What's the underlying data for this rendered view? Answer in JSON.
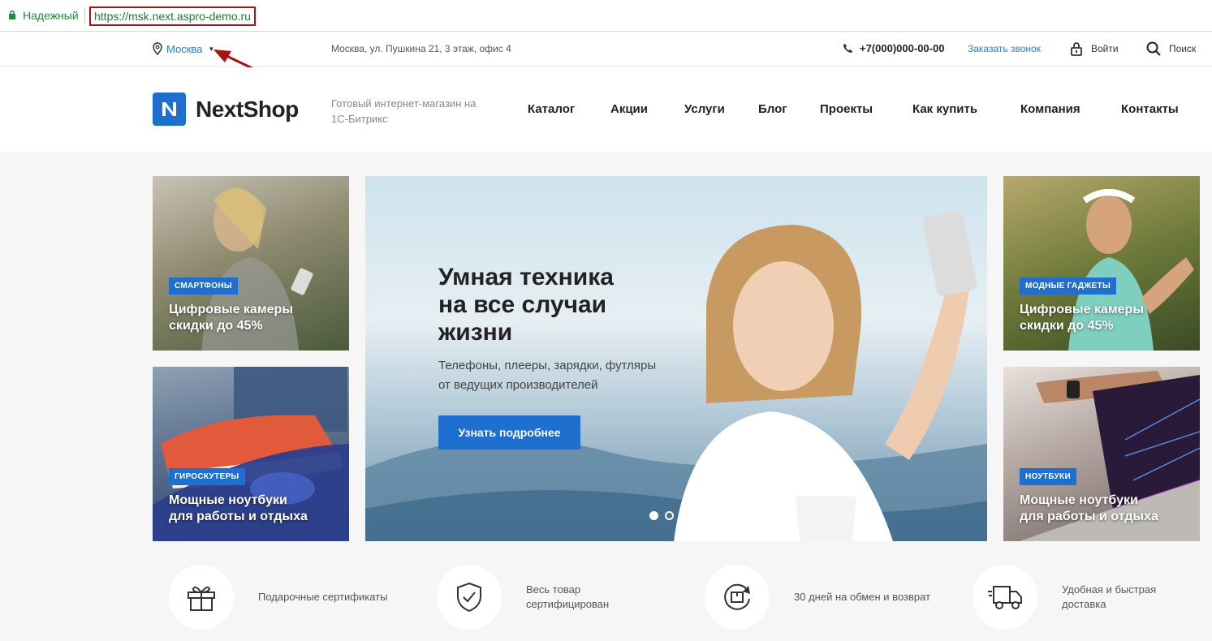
{
  "browser": {
    "secure_label": "Надежный",
    "url": "https://msk.next.aspro-demo.ru"
  },
  "topbar": {
    "city": "Москва",
    "address": "Москва, ул. Пушкина 21, 3 этаж, офис 4",
    "phone": "+7(000)000-00-00",
    "callback": "Заказать звонок",
    "login": "Войти",
    "search": "Поиск"
  },
  "header": {
    "logo_text": "NextShop",
    "tagline": "Готовый интернет-магазин на 1С-Битрикс",
    "nav": [
      "Каталог",
      "Акции",
      "Услуги",
      "Блог",
      "Проекты",
      "Как купить",
      "Компания",
      "Контакты"
    ]
  },
  "banners": {
    "left_top": {
      "badge": "СМАРТФОНЫ",
      "title": "Цифровые камеры\nскидки до 45%"
    },
    "left_bottom": {
      "badge": "ГИРОСКУТЕРЫ",
      "title": "Мощные ноутбуки\nдля работы и отдыха"
    },
    "right_top": {
      "badge": "МОДНЫЕ ГАДЖЕТЫ",
      "title": "Цифровые камеры\nскидки до 45%"
    },
    "right_bottom": {
      "badge": "НОУТБУКИ",
      "title": "Мощные ноутбуки\nдля работы и отдыха"
    }
  },
  "hero": {
    "title": "Умная техника\nна все случаи\nжизни",
    "subtitle": "Телефоны, плееры, зарядки, футляры\nот ведущих производителей",
    "button": "Узнать подробнее",
    "slides_total": 4,
    "active_slide": 1
  },
  "features": [
    {
      "icon": "gift-icon",
      "text": "Подарочные сертификаты"
    },
    {
      "icon": "shield-check-icon",
      "text": "Весь товар\nсертифицирован"
    },
    {
      "icon": "return-box-icon",
      "text": "30 дней на обмен и возврат"
    },
    {
      "icon": "delivery-truck-icon",
      "text": "Удобная и быстрая\nдоставка"
    }
  ],
  "colors": {
    "accent": "#1e6fcf",
    "link": "#2a7ec8",
    "annotation": "#a31515"
  }
}
